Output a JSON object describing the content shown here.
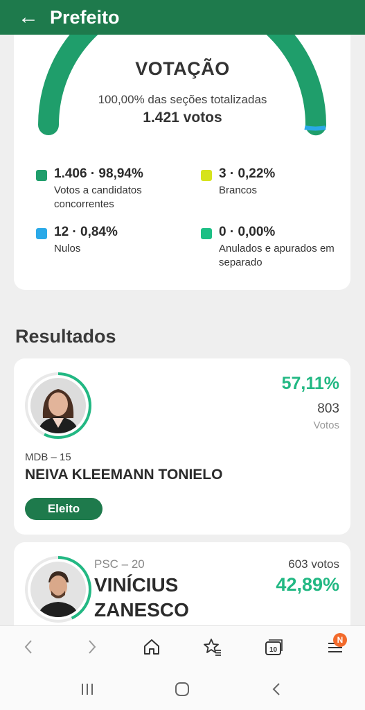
{
  "appbar": {
    "back_icon": "arrow-left-icon",
    "title": "Prefeito"
  },
  "summary": {
    "title": "VOTAÇÃO",
    "subtitle": "100,00% das seções totalizadas",
    "total": "1.421 votos",
    "gauge_fractions": {
      "candidatos": 0.9894,
      "brancos": 0.0022,
      "nulos": 0.0084,
      "anulados": 0.0
    },
    "legend": [
      {
        "value": "1.406 · 98,94%",
        "label": "Votos a candidatos concorrentes",
        "color": "#1f9e6b"
      },
      {
        "value": "3 · 0,22%",
        "label": "Brancos",
        "color": "#d6e31c"
      },
      {
        "value": "12 · 0,84%",
        "label": "Nulos",
        "color": "#2aa9e8"
      },
      {
        "value": "0 · 0,00%",
        "label": "Anulados e apurados em separado",
        "color": "#1dbf85"
      }
    ]
  },
  "results": {
    "section_title": "Resultados",
    "candidates": [
      {
        "percent": "57,11%",
        "percent_fraction": 0.5711,
        "votes": "803",
        "votes_label": "Votos",
        "party": "MDB – 15",
        "name": "NEIVA KLEEMANN TONIELO",
        "status": "Eleito"
      },
      {
        "party": "PSC – 20",
        "name": "VINÍCIUS ZANESCO",
        "votes": "603 votos",
        "percent": "42,89%",
        "percent_fraction": 0.4289
      }
    ]
  },
  "browser_toolbar": {
    "icons": [
      "chevron-left-icon",
      "chevron-right-icon",
      "home-icon",
      "bookmark-star-icon",
      "tabs-icon",
      "menu-icon"
    ],
    "tabs_count": "10",
    "menu_badge": "N"
  },
  "system_nav": {
    "icons": [
      "recent-apps-icon",
      "home-circle-icon",
      "back-chevron-icon"
    ]
  },
  "colors": {
    "brand": "#1e7a4c",
    "accent": "#22b883"
  }
}
